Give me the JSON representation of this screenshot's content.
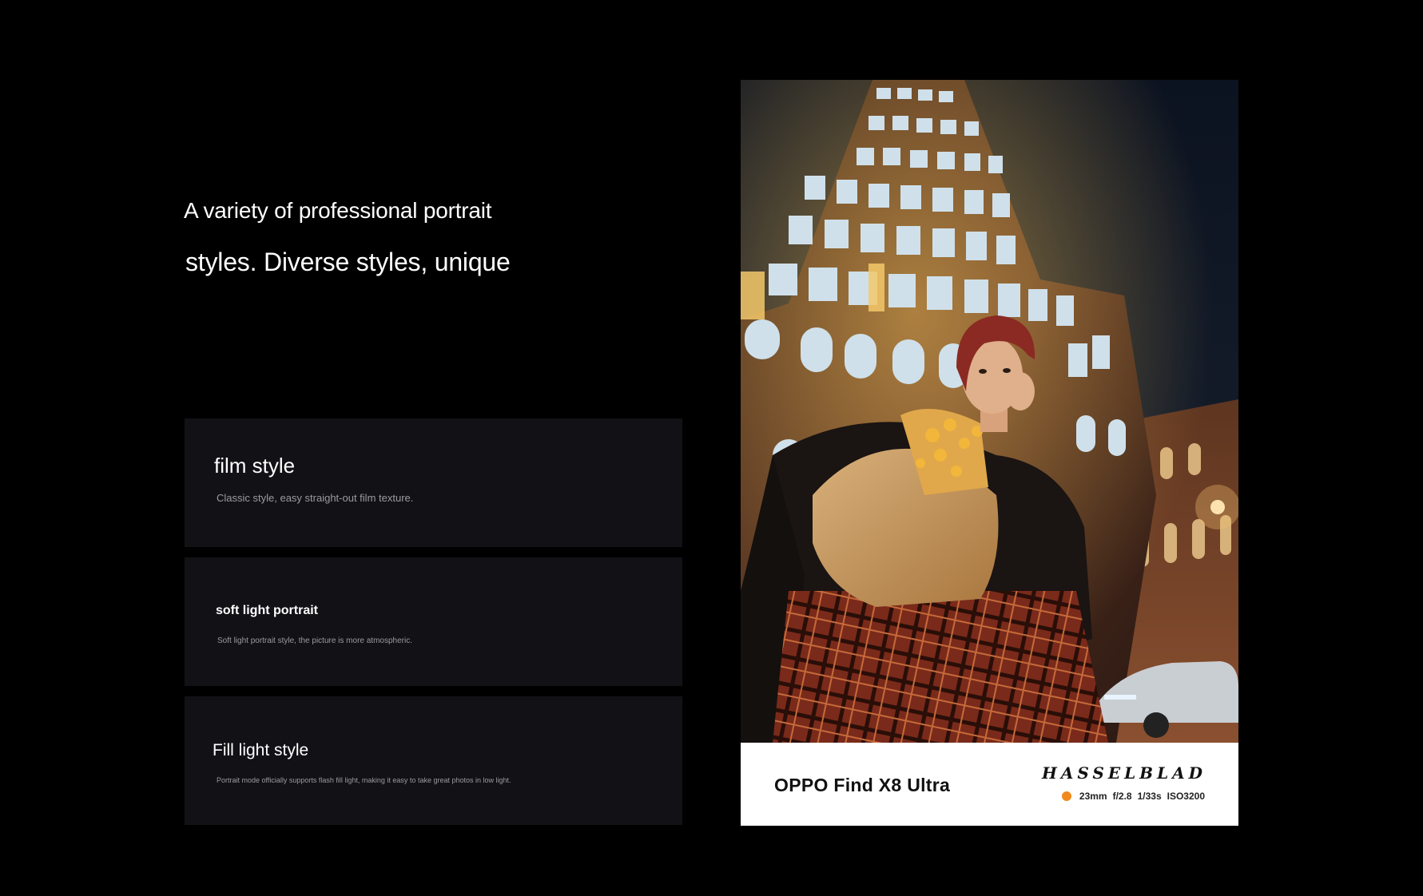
{
  "headline": {
    "line1": "A variety of professional portrait",
    "line2": "styles. Diverse styles, unique"
  },
  "cards": [
    {
      "title": "film style",
      "description": "Classic style, easy straight-out film texture."
    },
    {
      "title": "soft light portrait",
      "description": "Soft light portrait style, the picture is more atmospheric."
    },
    {
      "title": "Fill light style",
      "description": "Portrait mode officially supports flash fill light, making it easy to take great photos in low light."
    }
  ],
  "photo_caption": {
    "model": "OPPO Find X8 Ultra",
    "brand": "HASSELBLAD",
    "focal_length": "23mm",
    "aperture": "f/2.8",
    "shutter": "1/33s",
    "iso": "ISO3200",
    "accent_color": "#f08a1c"
  },
  "colors": {
    "background": "#000000",
    "card_background": "#121216"
  }
}
